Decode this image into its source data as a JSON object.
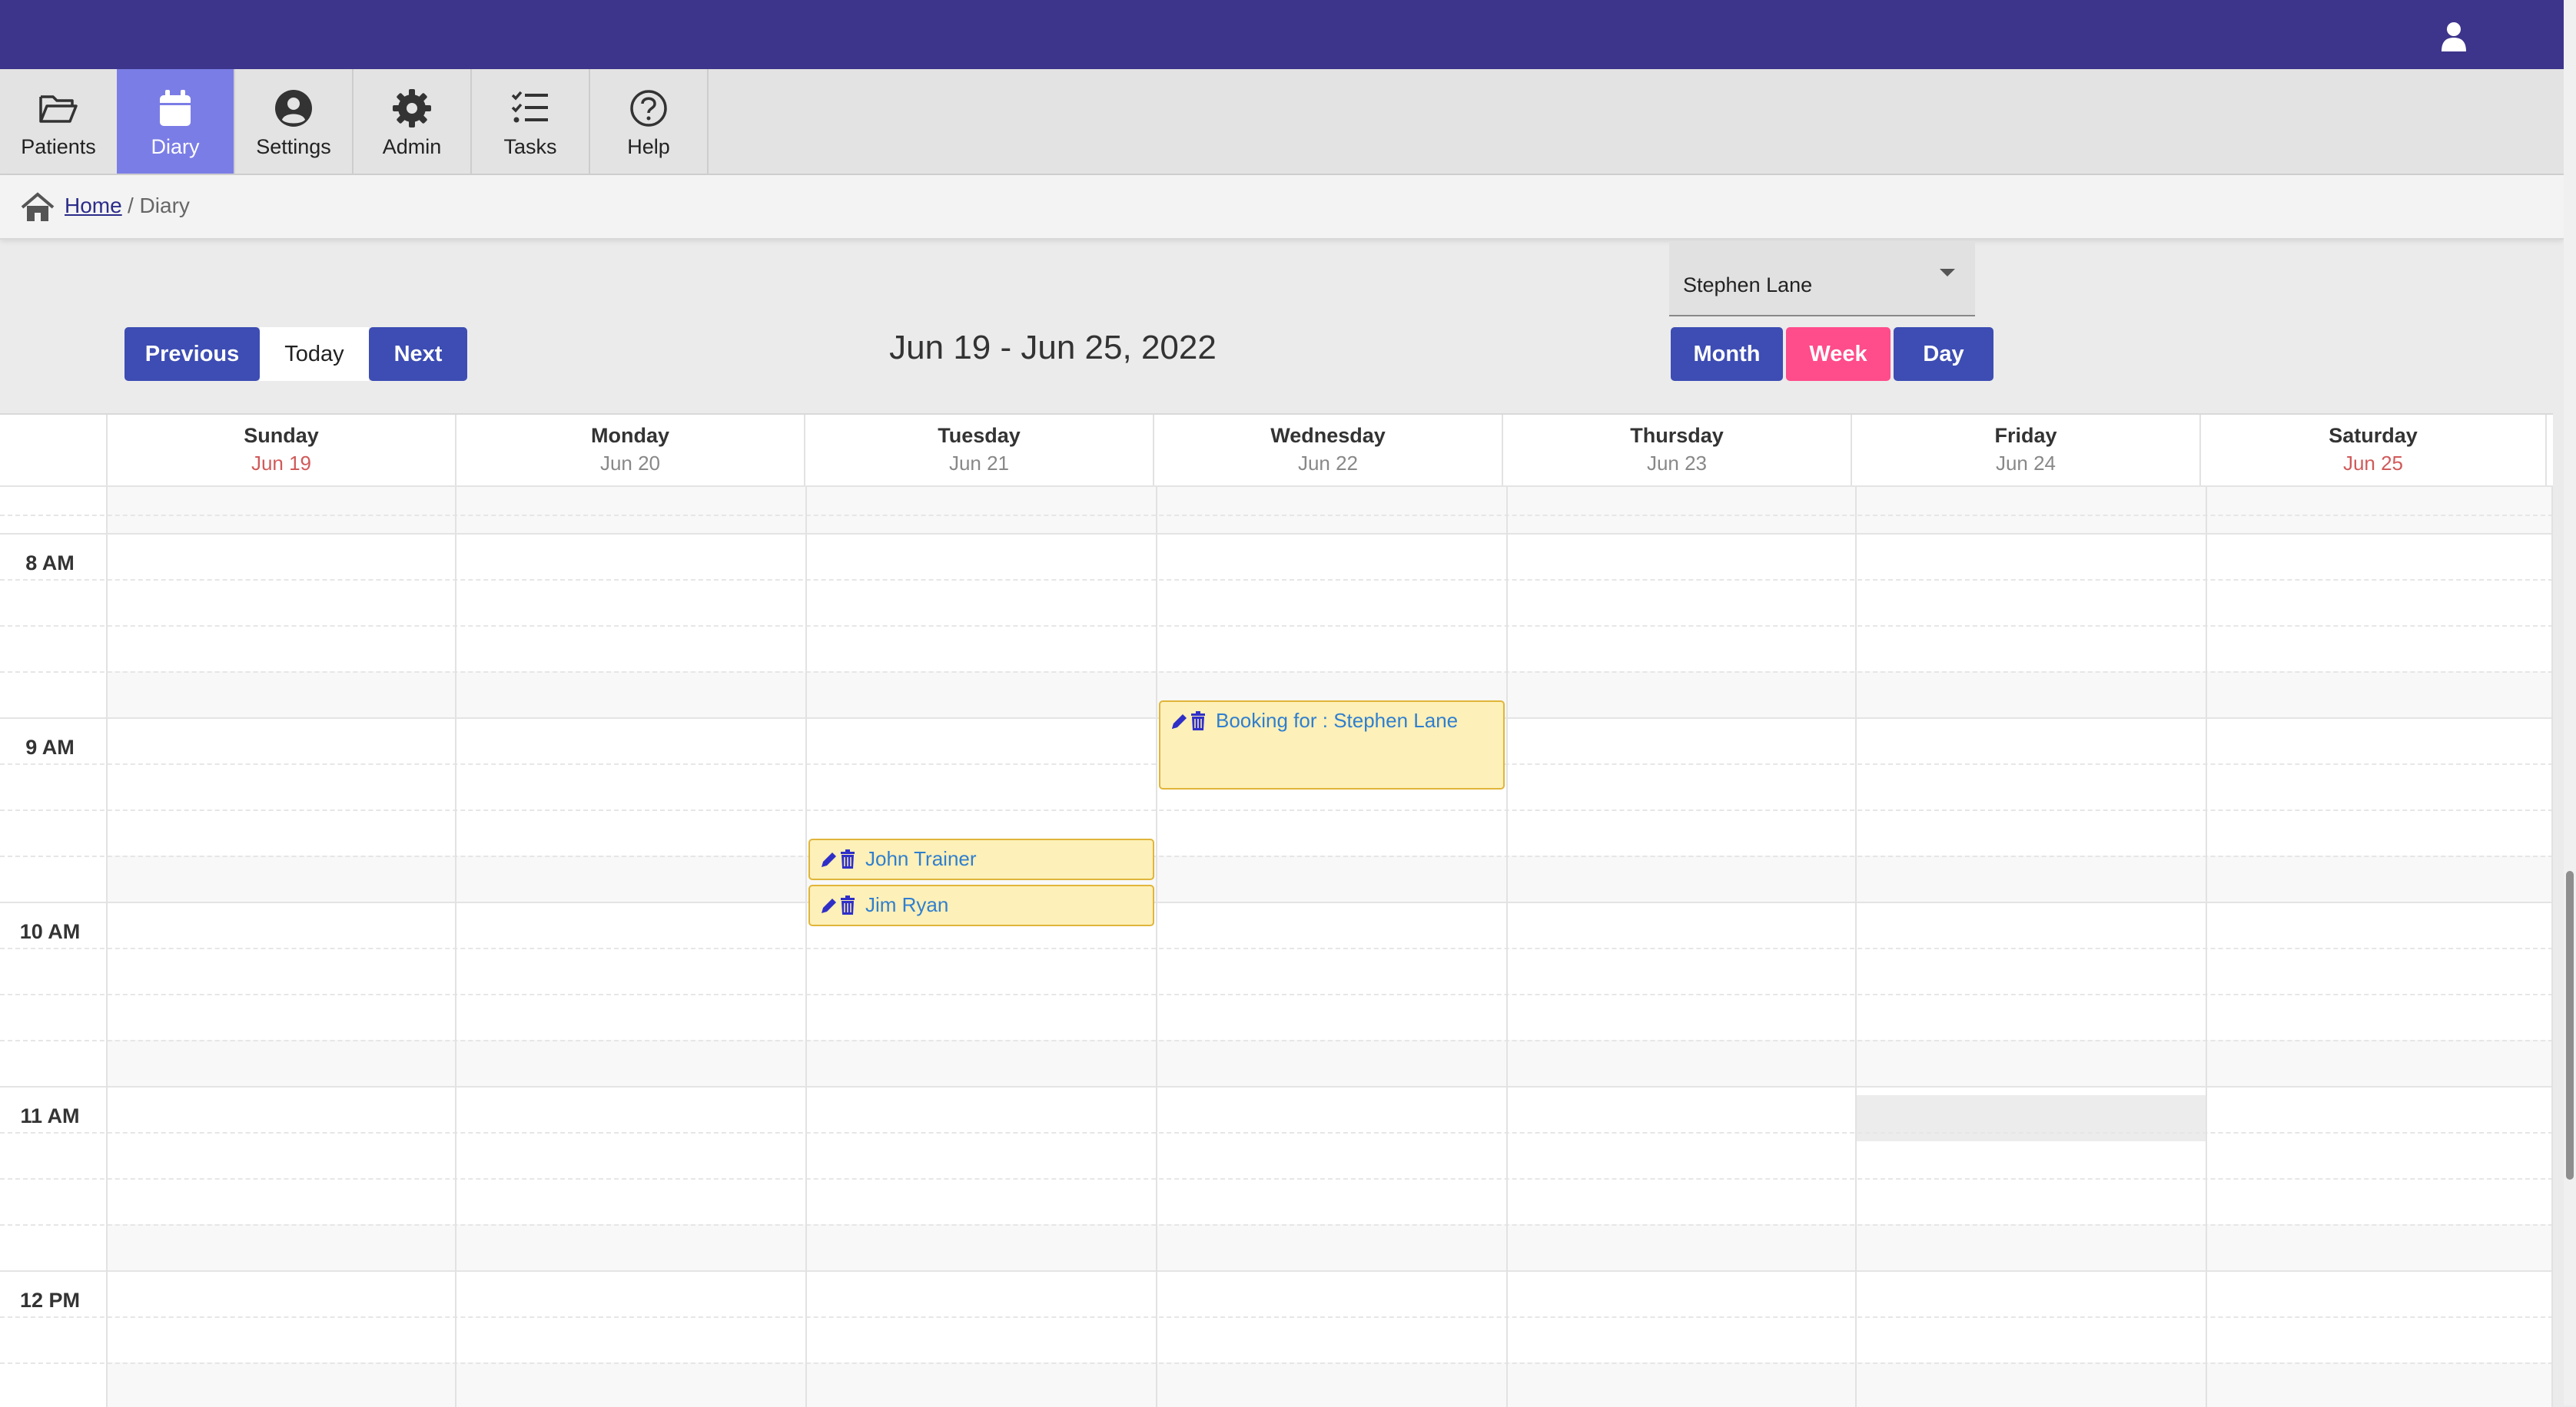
{
  "nav": {
    "items": [
      {
        "label": "Patients",
        "icon": "folder-open-icon"
      },
      {
        "label": "Diary",
        "icon": "calendar-icon",
        "active": true
      },
      {
        "label": "Settings",
        "icon": "user-circle-icon"
      },
      {
        "label": "Admin",
        "icon": "gear-icon"
      },
      {
        "label": "Tasks",
        "icon": "task-list-icon"
      },
      {
        "label": "Help",
        "icon": "help-icon"
      }
    ]
  },
  "breadcrumb": {
    "home": "Home",
    "current": "/ Diary"
  },
  "toolbar": {
    "previous": "Previous",
    "today": "Today",
    "next": "Next",
    "date_range": "Jun 19 - Jun 25, 2022",
    "practitioner": "Stephen Lane",
    "views": {
      "month": "Month",
      "week": "Week",
      "day": "Day"
    },
    "active_view": "Week"
  },
  "calendar": {
    "days": [
      {
        "name": "Sunday",
        "date": "Jun 19"
      },
      {
        "name": "Monday",
        "date": "Jun 20"
      },
      {
        "name": "Tuesday",
        "date": "Jun 21"
      },
      {
        "name": "Wednesday",
        "date": "Jun 22"
      },
      {
        "name": "Thursday",
        "date": "Jun 23"
      },
      {
        "name": "Friday",
        "date": "Jun 24"
      },
      {
        "name": "Saturday",
        "date": "Jun 25"
      }
    ],
    "hours": [
      "8 AM",
      "9 AM",
      "10 AM",
      "11 AM",
      "12 PM"
    ],
    "events": [
      {
        "day": "Wednesday",
        "start": "9:00 AM",
        "title": "Booking for : Stephen Lane"
      },
      {
        "day": "Tuesday",
        "start": "9:45 AM",
        "title": "John Trainer"
      },
      {
        "day": "Tuesday",
        "start": "10:00 AM",
        "title": "Jim Ryan"
      }
    ]
  },
  "colors": {
    "topbar": "#3d358b",
    "primary_button": "#3d4db3",
    "active_view": "#ff4c8b",
    "nav_active": "#7b7de6",
    "event_bg": "#fdf0b8",
    "event_text": "#2f7fd0"
  }
}
